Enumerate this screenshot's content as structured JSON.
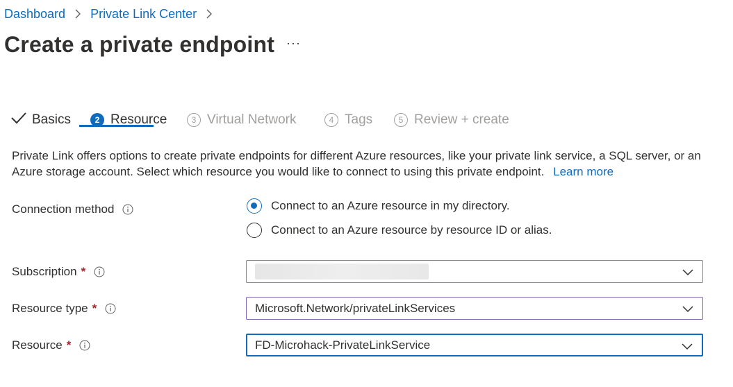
{
  "breadcrumb": {
    "items": [
      "Dashboard",
      "Private Link Center"
    ]
  },
  "page": {
    "title": "Create a private endpoint",
    "more": "···"
  },
  "tabs": [
    {
      "label": "Basics",
      "state": "done"
    },
    {
      "number": "2",
      "label": "Resource",
      "state": "active"
    },
    {
      "number": "3",
      "label": "Virtual Network",
      "state": "future"
    },
    {
      "number": "4",
      "label": "Tags",
      "state": "future"
    },
    {
      "number": "5",
      "label": "Review + create",
      "state": "future"
    }
  ],
  "description": {
    "text": "Private Link offers options to create private endpoints for different Azure resources, like your private link service, a SQL server, or an Azure storage account. Select which resource you would like to connect to using this private endpoint.",
    "link": "Learn more"
  },
  "form": {
    "connection_method": {
      "label": "Connection method",
      "options": [
        {
          "label": "Connect to an Azure resource in my directory.",
          "selected": true
        },
        {
          "label": "Connect to an Azure resource by resource ID or alias.",
          "selected": false
        }
      ]
    },
    "subscription": {
      "label": "Subscription",
      "required": "*",
      "value": ""
    },
    "resource_type": {
      "label": "Resource type",
      "required": "*",
      "value": "Microsoft.Network/privateLinkServices"
    },
    "resource": {
      "label": "Resource",
      "required": "*",
      "value": "FD-Microhack-PrivateLinkService"
    }
  },
  "colors": {
    "accent": "#0f6cbd",
    "required": "#a4262c",
    "muted": "#a19f9d"
  }
}
